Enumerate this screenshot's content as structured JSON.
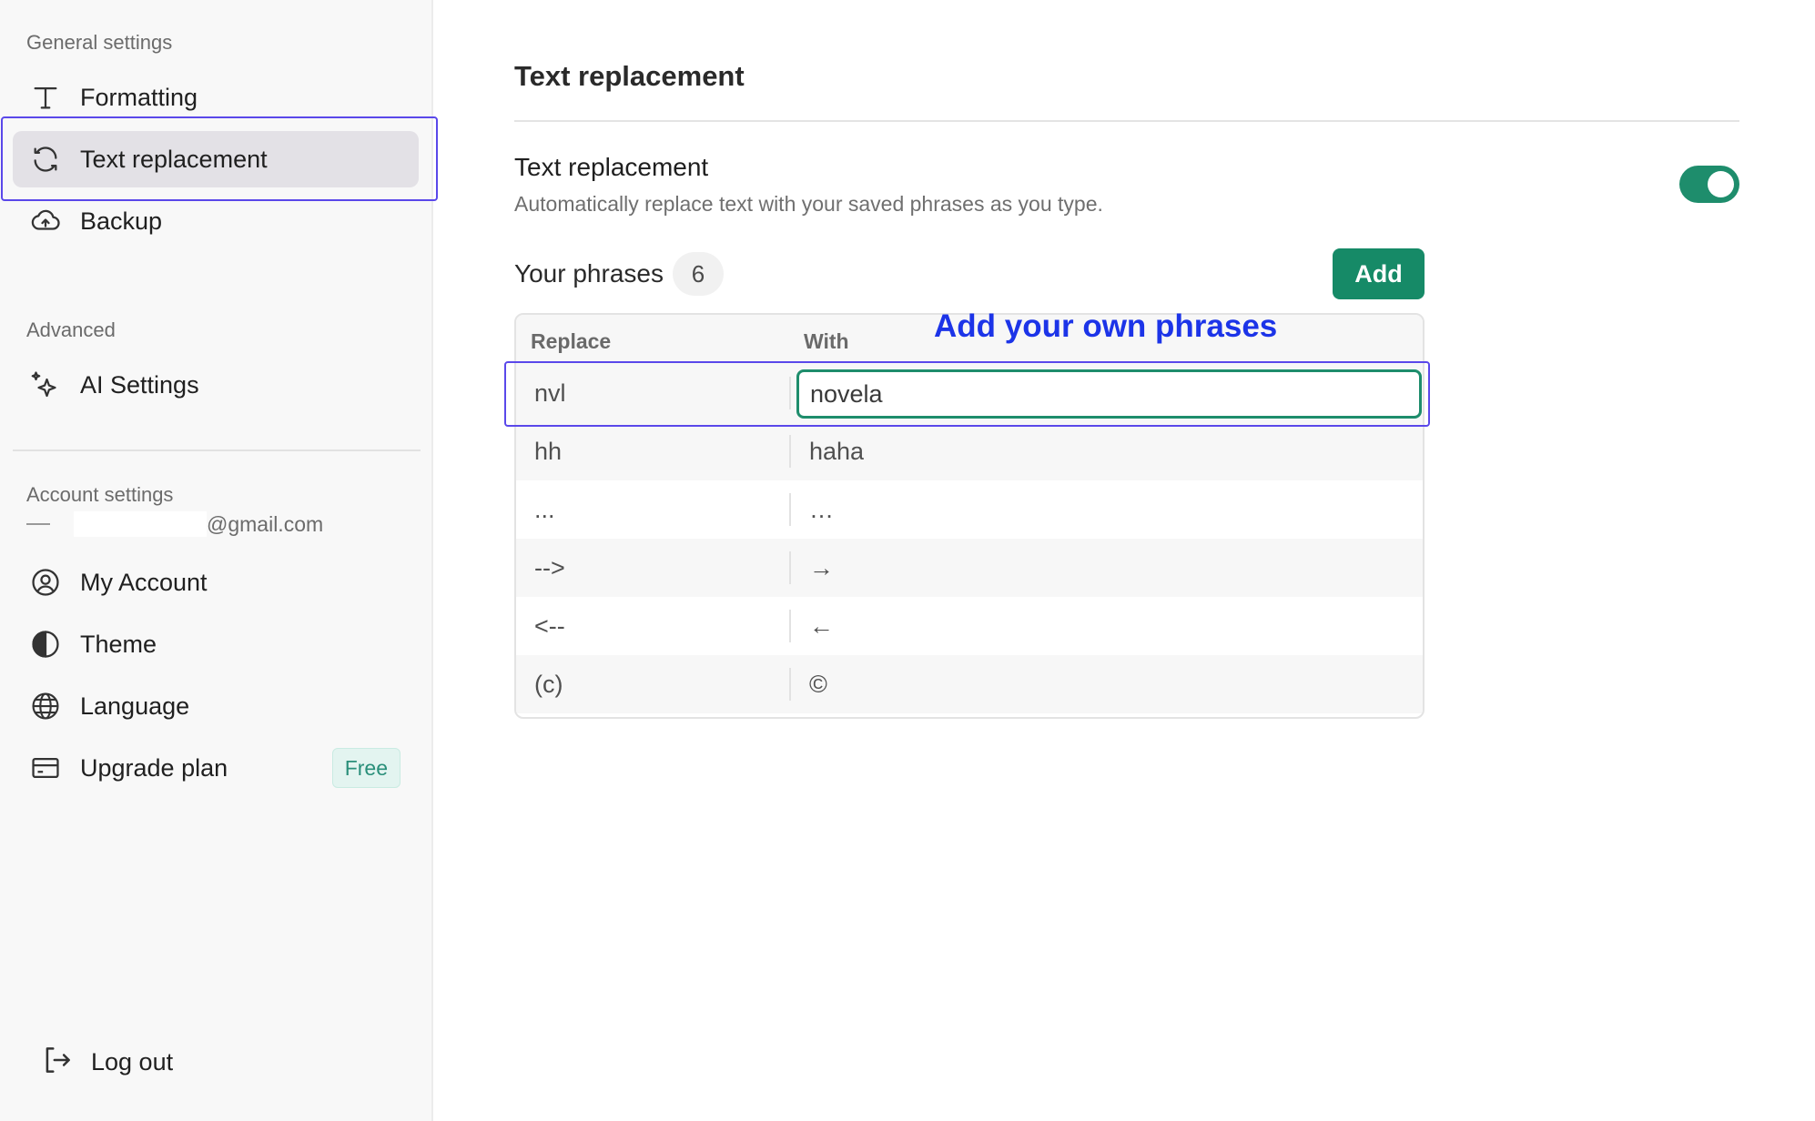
{
  "sidebar": {
    "general_label": "General settings",
    "items": [
      {
        "label": "Formatting",
        "icon": "type-icon"
      },
      {
        "label": "Text replacement",
        "icon": "refresh-icon",
        "active": true
      },
      {
        "label": "Backup",
        "icon": "cloud-upload-icon"
      }
    ],
    "advanced_label": "Advanced",
    "advanced_items": [
      {
        "label": "AI Settings",
        "icon": "sparkles-icon"
      }
    ],
    "account_label": "Account settings",
    "email_suffix": "@gmail.com",
    "account_items": [
      {
        "label": "My Account",
        "icon": "user-circle-icon"
      },
      {
        "label": "Theme",
        "icon": "contrast-icon"
      },
      {
        "label": "Language",
        "icon": "globe-icon"
      },
      {
        "label": "Upgrade plan",
        "icon": "credit-card-icon",
        "badge": "Free"
      }
    ],
    "logout_label": "Log out"
  },
  "main": {
    "title": "Text replacement",
    "setting": {
      "title": "Text replacement",
      "description": "Automatically replace text with your saved phrases as you type.",
      "enabled": true
    },
    "phrases_label": "Your phrases",
    "phrases_count": "6",
    "add_label": "Add",
    "annotation": "Add your own phrases",
    "table": {
      "headers": {
        "replace": "Replace",
        "with": "With"
      },
      "rows": [
        {
          "replace": "nvl",
          "with": "novela"
        },
        {
          "replace": "hh",
          "with": "haha"
        },
        {
          "replace": "...",
          "with": "…"
        },
        {
          "replace": "-->",
          "with": "→"
        },
        {
          "replace": "<--",
          "with": "←"
        },
        {
          "replace": "(c)",
          "with": "©"
        }
      ]
    }
  },
  "colors": {
    "accent": "#168a67",
    "highlight_outline": "#5a48ea",
    "annotation": "#1c34e8"
  }
}
